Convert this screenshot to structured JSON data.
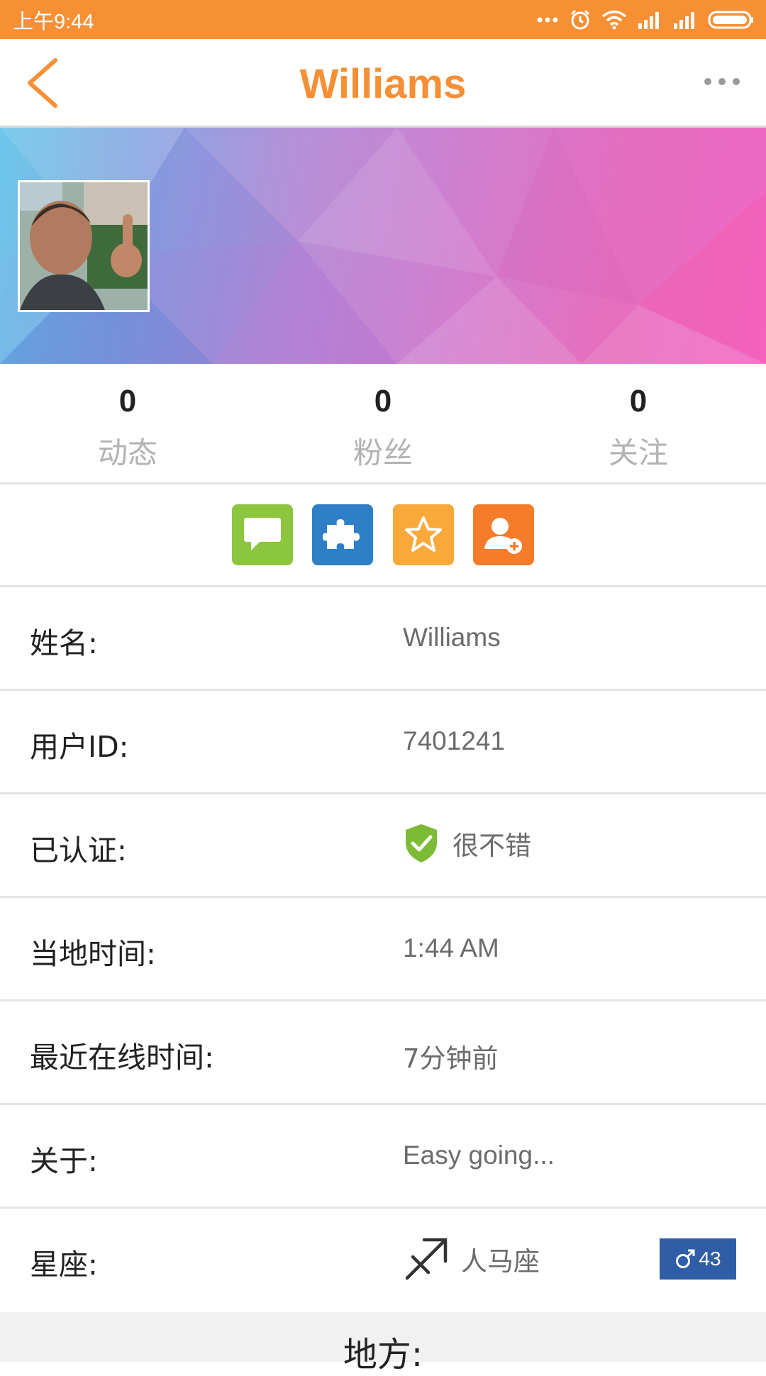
{
  "status_bar": {
    "time": "上午9:44",
    "icons": [
      "dots-icon",
      "alarm-icon",
      "wifi-icon",
      "signal-icon",
      "signal-icon",
      "battery-icon"
    ],
    "background": "#f78f35"
  },
  "header": {
    "title": "Williams",
    "accent_color": "#f78f35"
  },
  "stats": [
    {
      "value": "0",
      "label": "动态"
    },
    {
      "value": "0",
      "label": "粉丝"
    },
    {
      "value": "0",
      "label": "关注"
    }
  ],
  "actions": [
    {
      "name": "message-button",
      "icon": "chat-bubble-icon",
      "color": "#8cc63f"
    },
    {
      "name": "puzzle-button",
      "icon": "puzzle-icon",
      "color": "#2f7fc6"
    },
    {
      "name": "favorite-button",
      "icon": "star-icon",
      "color": "#f9a93a"
    },
    {
      "name": "add-friend-button",
      "icon": "add-user-icon",
      "color": "#f57c2a"
    }
  ],
  "profile": {
    "name_label": "姓名:",
    "name_value": "Williams",
    "id_label": "用户ID:",
    "id_value": "7401241",
    "verified_label": "已认证:",
    "verified_value": "很不错",
    "local_time_label": "当地时间:",
    "local_time_value": "1:44 AM",
    "last_online_label": "最近在线时间:",
    "last_online_value": "7分钟前",
    "about_label": "关于:",
    "about_value": "Easy going...",
    "zodiac_label": "星座:",
    "zodiac_value": "人马座",
    "gender_age": "43"
  },
  "next_section": {
    "title": "地方:"
  }
}
